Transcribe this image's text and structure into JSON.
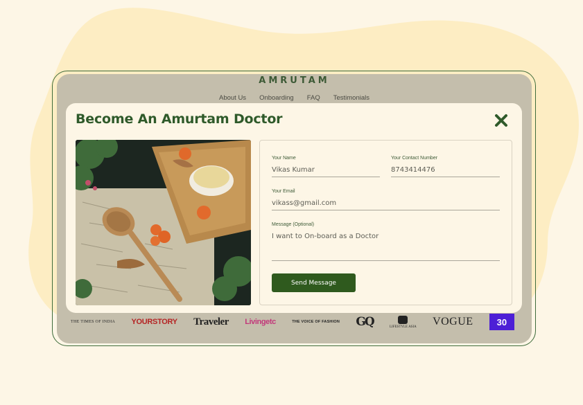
{
  "site": {
    "brand": "AMRUTAM",
    "nav": [
      "About Us",
      "Onboarding",
      "FAQ",
      "Testimonials"
    ]
  },
  "modal": {
    "title": "Become An Amurtam Doctor",
    "form": {
      "name_label": "Your Name",
      "name_value": "Vikas Kumar",
      "contact_label": "Your Contact Number",
      "contact_value": "8743414476",
      "email_label": "Your Email",
      "email_value": "vikass@gmail.com",
      "message_label": "Message (Optional)",
      "message_value": "I want to On-board as a Doctor",
      "submit_label": "Send Message"
    }
  },
  "press_logos": [
    "THE TIMES OF INDIA",
    "YOURSTORY",
    "Traveler",
    "Livingetc",
    "THE VOICE OF FASHION",
    "GQ",
    "LIFESTYLE ASIA",
    "VOGUE",
    "30"
  ],
  "colors": {
    "accent": "#2f5a2a",
    "button": "#2f5a1e",
    "overlay": "#c4beac",
    "background": "#fdf6e6"
  }
}
